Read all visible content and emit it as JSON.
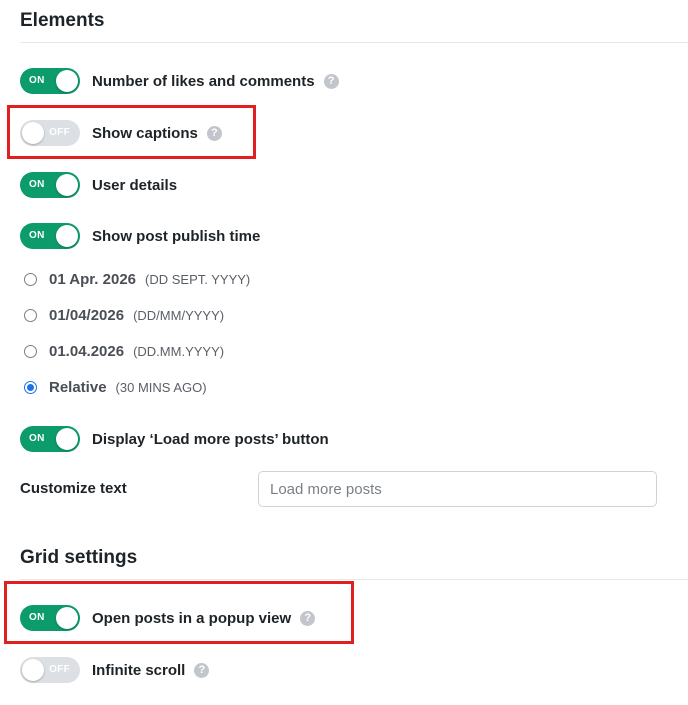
{
  "elements_section": {
    "title": "Elements",
    "toggles": [
      {
        "label": "Number of likes and comments",
        "state": "ON",
        "on": true,
        "help": true
      },
      {
        "label": "Show captions",
        "state": "OFF",
        "on": false,
        "help": true
      },
      {
        "label": "User details",
        "state": "ON",
        "on": true,
        "help": false
      },
      {
        "label": "Show post publish time",
        "state": "ON",
        "on": true,
        "help": false
      }
    ],
    "date_formats": [
      {
        "label": "01 Apr. 2026",
        "hint": "(DD SEPT. YYYY)",
        "checked": false
      },
      {
        "label": "01/04/2026",
        "hint": "(DD/MM/YYYY)",
        "checked": false
      },
      {
        "label": "01.04.2026",
        "hint": "(DD.MM.YYYY)",
        "checked": false
      },
      {
        "label": "Relative",
        "hint": "(30 MINS AGO)",
        "checked": true
      }
    ],
    "load_more": {
      "label": "Display ‘Load more posts’ button",
      "state": "ON",
      "on": true
    },
    "customize_text": {
      "label": "Customize text",
      "placeholder": "Load more posts",
      "value": ""
    }
  },
  "grid_section": {
    "title": "Grid settings",
    "toggles": [
      {
        "label": "Open posts in a popup view",
        "state": "ON",
        "on": true,
        "help": true
      },
      {
        "label": "Infinite scroll",
        "state": "OFF",
        "on": false,
        "help": true
      }
    ]
  },
  "help_icon_glyph": "?",
  "colors": {
    "toggle_on": "#0c9b6b",
    "toggle_off": "#dcdfe4",
    "radio_checked": "#1a73e8",
    "annotation_box": "#e0201f"
  }
}
